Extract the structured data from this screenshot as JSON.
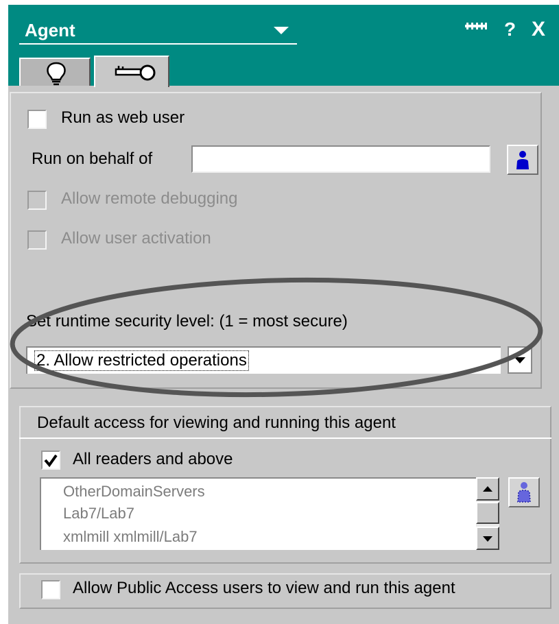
{
  "header": {
    "title": "Agent",
    "help_label": "?",
    "close_label": "X"
  },
  "tabs": [
    {
      "icon": "lightbulb-icon",
      "active": false
    },
    {
      "icon": "key-icon",
      "active": true
    }
  ],
  "security": {
    "run_as_web_user": {
      "label": "Run as web user",
      "checked": false
    },
    "run_on_behalf_of": {
      "label": "Run on behalf of",
      "value": ""
    },
    "allow_remote_debugging": {
      "label": "Allow remote debugging",
      "checked": false,
      "enabled": false
    },
    "allow_user_activation": {
      "label": "Allow user activation",
      "checked": false,
      "enabled": false
    },
    "runtime_level_label": "Set runtime security level: (1 = most secure)",
    "runtime_level_value": "2. Allow restricted operations"
  },
  "access": {
    "section_title": "Default access for viewing and running this agent",
    "all_readers": {
      "label": "All readers and above",
      "checked": true
    },
    "list_items": [
      "OtherDomainServers",
      "Lab7/Lab7",
      "xmlmill xmlmill/Lab7"
    ],
    "public_access": {
      "label": "Allow Public Access users to view and run this agent",
      "checked": false
    }
  },
  "colors": {
    "header": "#008a82",
    "panel": "#c8c8c8",
    "annotation_ellipse": "#555555",
    "person_icon": "#0000cc"
  }
}
